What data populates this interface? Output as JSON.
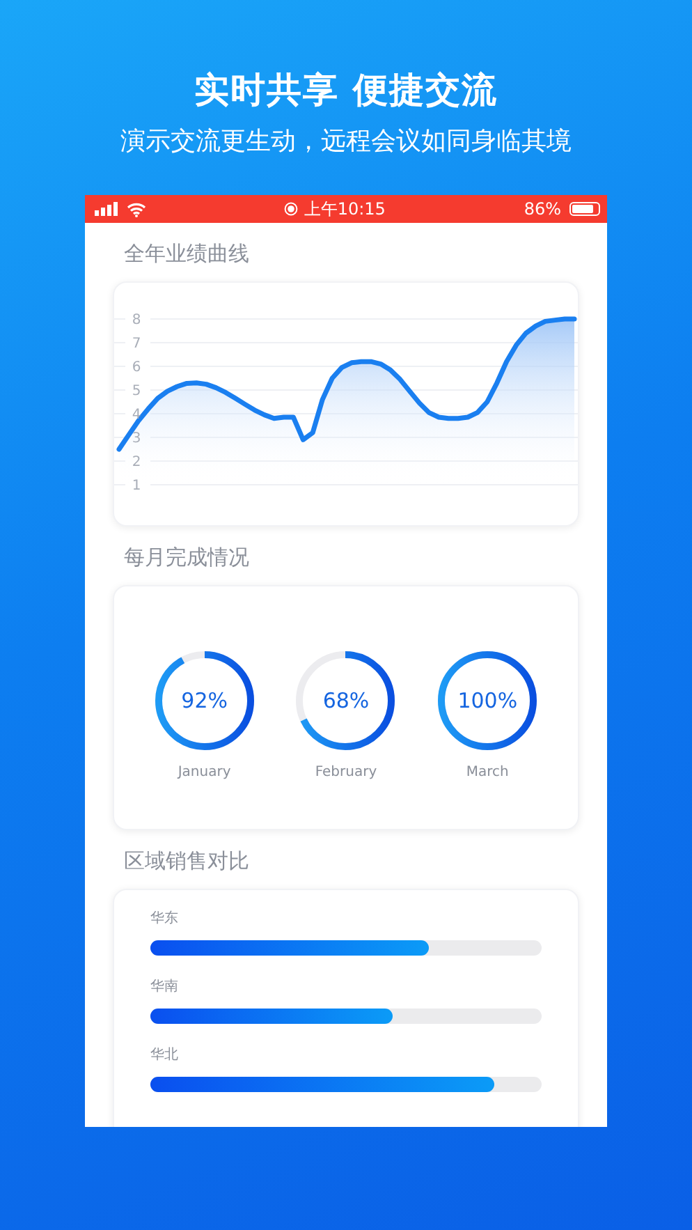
{
  "headline": "实时共享 便捷交流",
  "subheadline": "演示交流更生动，远程会议如同身临其境",
  "status_bar": {
    "time": "上午10:15",
    "battery": "86%"
  },
  "sections": [
    {
      "kind": "line",
      "title": "全年业绩曲线",
      "chart_data": {
        "type": "area",
        "categories": [
          null,
          null,
          null,
          null,
          null,
          null,
          null,
          null,
          null,
          null,
          null,
          null,
          null,
          null,
          null,
          null,
          null,
          null,
          null,
          null,
          null,
          null,
          null,
          null,
          null,
          null,
          null,
          null,
          null,
          null,
          null,
          null,
          null,
          null,
          null,
          null,
          null,
          null,
          null,
          null,
          null,
          null,
          null,
          null,
          null,
          null,
          null,
          null
        ],
        "ylim": [
          1,
          8
        ],
        "grid": true,
        "yticks": [
          1,
          2,
          3,
          4,
          5,
          6,
          7,
          8
        ],
        "series": [
          {
            "color": "#1a7ff0",
            "values": [
              2.5,
              3.1,
              3.7,
              4.2,
              4.65,
              4.95,
              5.15,
              5.28,
              5.3,
              5.25,
              5.1,
              4.9,
              4.65,
              4.4,
              4.15,
              3.95,
              3.8,
              3.85,
              3.85,
              2.9,
              3.2,
              4.6,
              5.5,
              5.95,
              6.15,
              6.2,
              6.2,
              6.1,
              5.85,
              5.45,
              4.95,
              4.45,
              4.05,
              3.85,
              3.8,
              3.8,
              3.85,
              4.05,
              4.5,
              5.3,
              6.2,
              6.9,
              7.4,
              7.7,
              7.9,
              7.95,
              8.0,
              8.0
            ]
          }
        ]
      }
    },
    {
      "kind": "rings",
      "title": "每月完成情况",
      "items": [
        {
          "value": "92%",
          "label": "January",
          "level": 0.92
        },
        {
          "value": "68%",
          "label": "February",
          "level": 0.68
        },
        {
          "value": "100%",
          "label": "March",
          "level": 1
        }
      ]
    },
    {
      "kind": "bars",
      "title": "区域销售对比",
      "items": [
        {
          "label": "华东",
          "level": 0.71
        },
        {
          "label": "华南",
          "level": 0.62
        },
        {
          "label": "华北",
          "level": 0.88
        }
      ]
    }
  ]
}
